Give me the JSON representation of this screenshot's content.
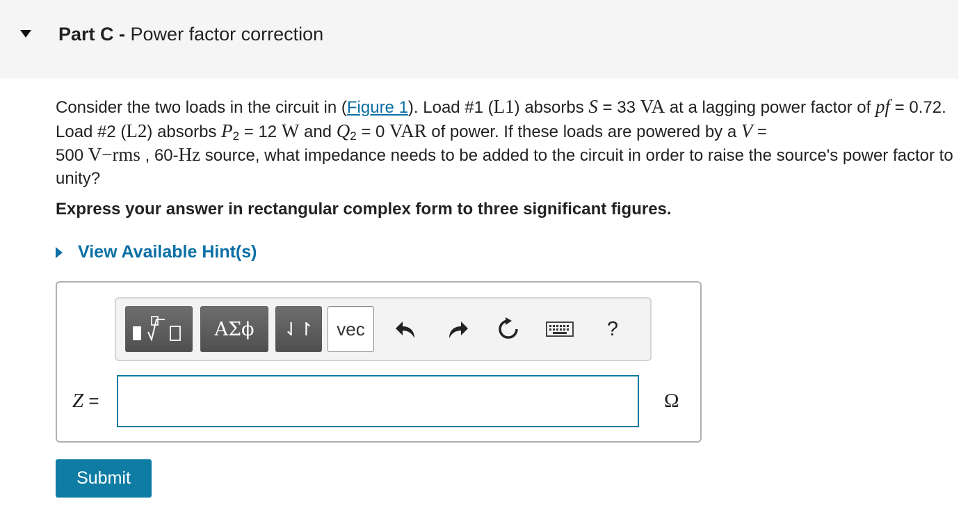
{
  "header": {
    "part_label": "Part C",
    "separator": " - ",
    "title": "Power factor correction"
  },
  "problem": {
    "t1": "Consider the two loads in the circuit in (",
    "figure_link": "Figure 1",
    "t2": "). Load #1 (",
    "L1": "L1",
    "t3": ") absorbs ",
    "S_sym": "S",
    "t4": " = 33 ",
    "VA": "VA",
    "t5": " at a lagging power factor of ",
    "pf_sym": "pf",
    "t6": " = 0.72. Load #2 (",
    "L2": "L2",
    "t7": ") absorbs ",
    "P_sym": "P",
    "P_sub": "2",
    "t8": " = 12 ",
    "W": "W",
    "t9": " and ",
    "Q_sym": "Q",
    "Q_sub": "2",
    "t10": " = 0 ",
    "VAR": "VAR",
    "t11": " of power. If these loads are powered by a ",
    "V_sym": "V",
    "t12": " =",
    "t13": "500 ",
    "Vrms": "V−rms",
    "t14": " , 60-",
    "Hz": "Hz",
    "t15": " source, what impedance needs to be added to the circuit in order to raise the source's power factor to unity?"
  },
  "instruction": "Express your answer in rectangular complex form to three significant figures.",
  "hint_label": "View Available Hint(s)",
  "toolbar": {
    "greek_label": "ΑΣϕ",
    "arrows_label": "⇃↾",
    "vec_label": "vec",
    "help_label": "?"
  },
  "answer": {
    "variable": "Z",
    "equals": " =",
    "value": "",
    "unit": "Ω"
  },
  "submit_label": "Submit",
  "colors": {
    "accent": "#0f7da3",
    "link": "#0b6fa4",
    "header_bg": "#f5f5f5"
  }
}
